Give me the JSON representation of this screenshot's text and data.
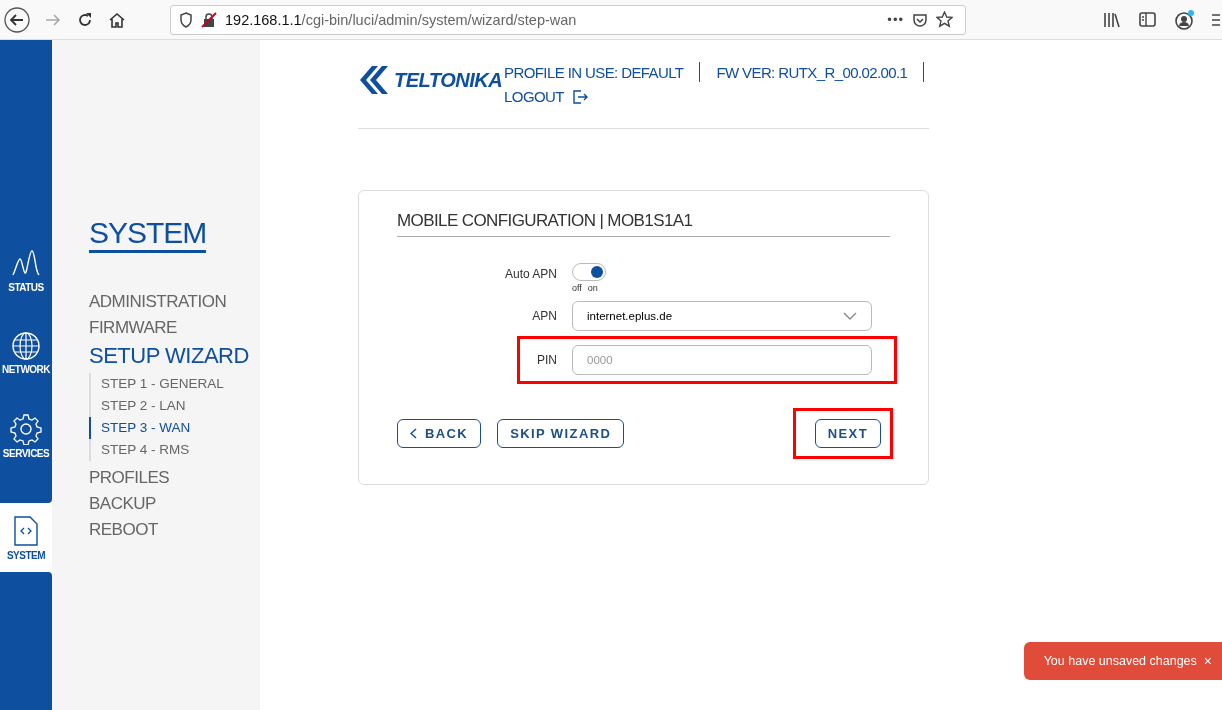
{
  "browser": {
    "url_host": "192.168.1.1",
    "url_path": "/cgi-bin/luci/admin/system/wizard/step-wan",
    "page_actions": "•••"
  },
  "rail": [
    {
      "label": "STATUS",
      "kind": "status",
      "selected": false
    },
    {
      "label": "NETWORK",
      "kind": "network",
      "selected": false
    },
    {
      "label": "SERVICES",
      "kind": "services",
      "selected": false
    },
    {
      "label": "SYSTEM",
      "kind": "system",
      "selected": true
    }
  ],
  "sidebar": {
    "title": "SYSTEM",
    "items": [
      {
        "label": "ADMINISTRATION",
        "selected": false
      },
      {
        "label": "FIRMWARE",
        "selected": false
      },
      {
        "label": "SETUP WIZARD",
        "selected": true,
        "children": [
          {
            "label": "STEP 1 - GENERAL",
            "selected": false
          },
          {
            "label": "STEP 2 - LAN",
            "selected": false
          },
          {
            "label": "STEP 3 - WAN",
            "selected": true
          },
          {
            "label": "STEP 4 - RMS",
            "selected": false
          }
        ]
      },
      {
        "label": "PROFILES",
        "selected": false
      },
      {
        "label": "BACKUP",
        "selected": false
      },
      {
        "label": "REBOOT",
        "selected": false
      }
    ]
  },
  "header": {
    "logo": "TELTONIKA",
    "profile": "PROFILE IN USE: DEFAULT",
    "firmware": "FW VER: RUTX_R_00.02.00.1",
    "logout": "LOGOUT"
  },
  "card": {
    "title": "MOBILE CONFIGURATION | MOB1S1A1",
    "fields": [
      {
        "kind": "toggle",
        "label": "Auto APN",
        "on": true,
        "off_label": "off",
        "on_label": "on",
        "highlighted": false
      },
      {
        "kind": "select",
        "label": "APN",
        "value": "internet.eplus.de",
        "highlighted": false
      },
      {
        "kind": "input",
        "label": "PIN",
        "placeholder": "0000",
        "highlighted": true
      }
    ],
    "buttons": [
      {
        "label": "BACK",
        "kind": "back",
        "highlighted": false
      },
      {
        "label": "SKIP WIZARD",
        "kind": "plain",
        "highlighted": false
      },
      {
        "label": "NEXT",
        "kind": "next",
        "highlighted": true
      }
    ]
  },
  "toast": {
    "text": "You have unsaved changes",
    "close": "×"
  }
}
